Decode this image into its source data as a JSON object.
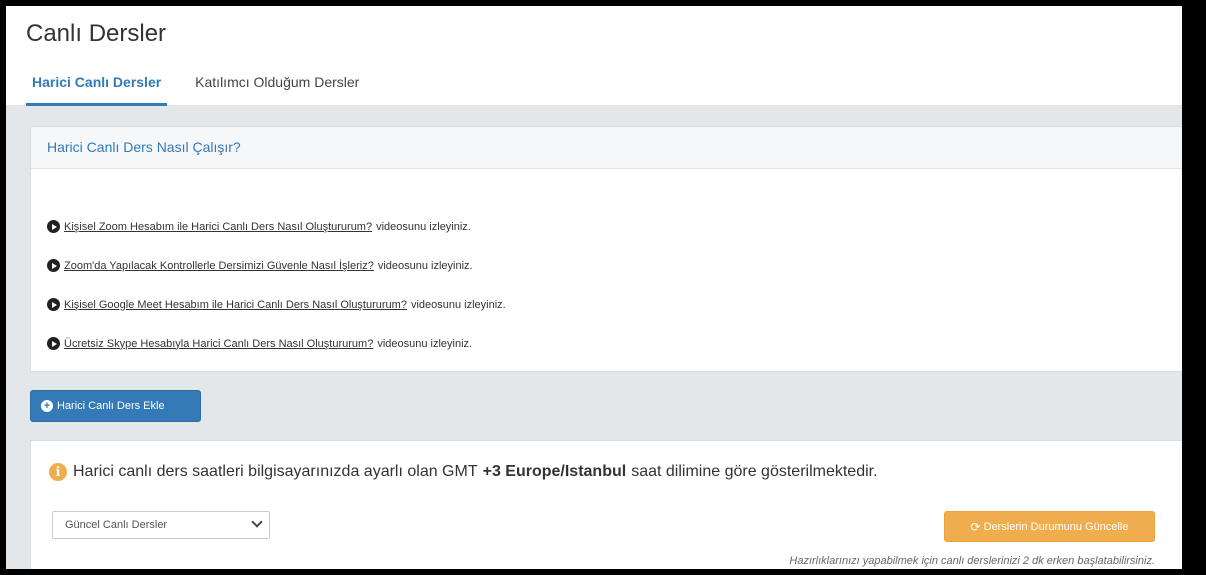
{
  "header": {
    "title": "Canlı Dersler",
    "tabs": [
      {
        "label": "Harici Canlı Dersler",
        "active": true
      },
      {
        "label": "Katılımcı Olduğum Dersler",
        "active": false
      }
    ]
  },
  "info_panel": {
    "title": "Harici Canlı Ders Nasıl Çalışır?",
    "videos": [
      {
        "link": "Kişisel Zoom Hesabım ile Harici Canlı Ders Nasıl Oluştururum?",
        "suffix": "videosunu izleyiniz."
      },
      {
        "link": "Zoom'da Yapılacak Kontrollerle Dersimizi Güvenle Nasıl İşleriz?",
        "suffix": "videosunu izleyiniz."
      },
      {
        "link": "Kişisel Google Meet Hesabım ile Harici Canlı Ders Nasıl Oluştururum?",
        "suffix": "videosunu izleyiniz."
      },
      {
        "link": "Ücretsiz Skype Hesabıyla Harici Canlı Ders Nasıl Oluştururum?",
        "suffix": "videosunu izleyiniz."
      }
    ]
  },
  "add_button": {
    "label": "Harici Canlı Ders Ekle"
  },
  "lessons": {
    "notice_pre": "Harici canlı ders saatleri bilgisayarınızda ayarlı olan GMT",
    "notice_bold": "+3 Europe/Istanbul",
    "notice_post": "saat dilimine göre gösterilmektedir.",
    "filter_selected": "Güncel Canlı Dersler",
    "update_label": "Derslerin Durumunu Güncelle",
    "hint": "Hazırlıklarınızı yapabilmek için canlı derslerinizi 2 dk erken başlatabilirsiniz."
  },
  "colors": {
    "primary": "#337ab7",
    "warning": "#f0ad4e",
    "background": "#e3e7ea"
  }
}
